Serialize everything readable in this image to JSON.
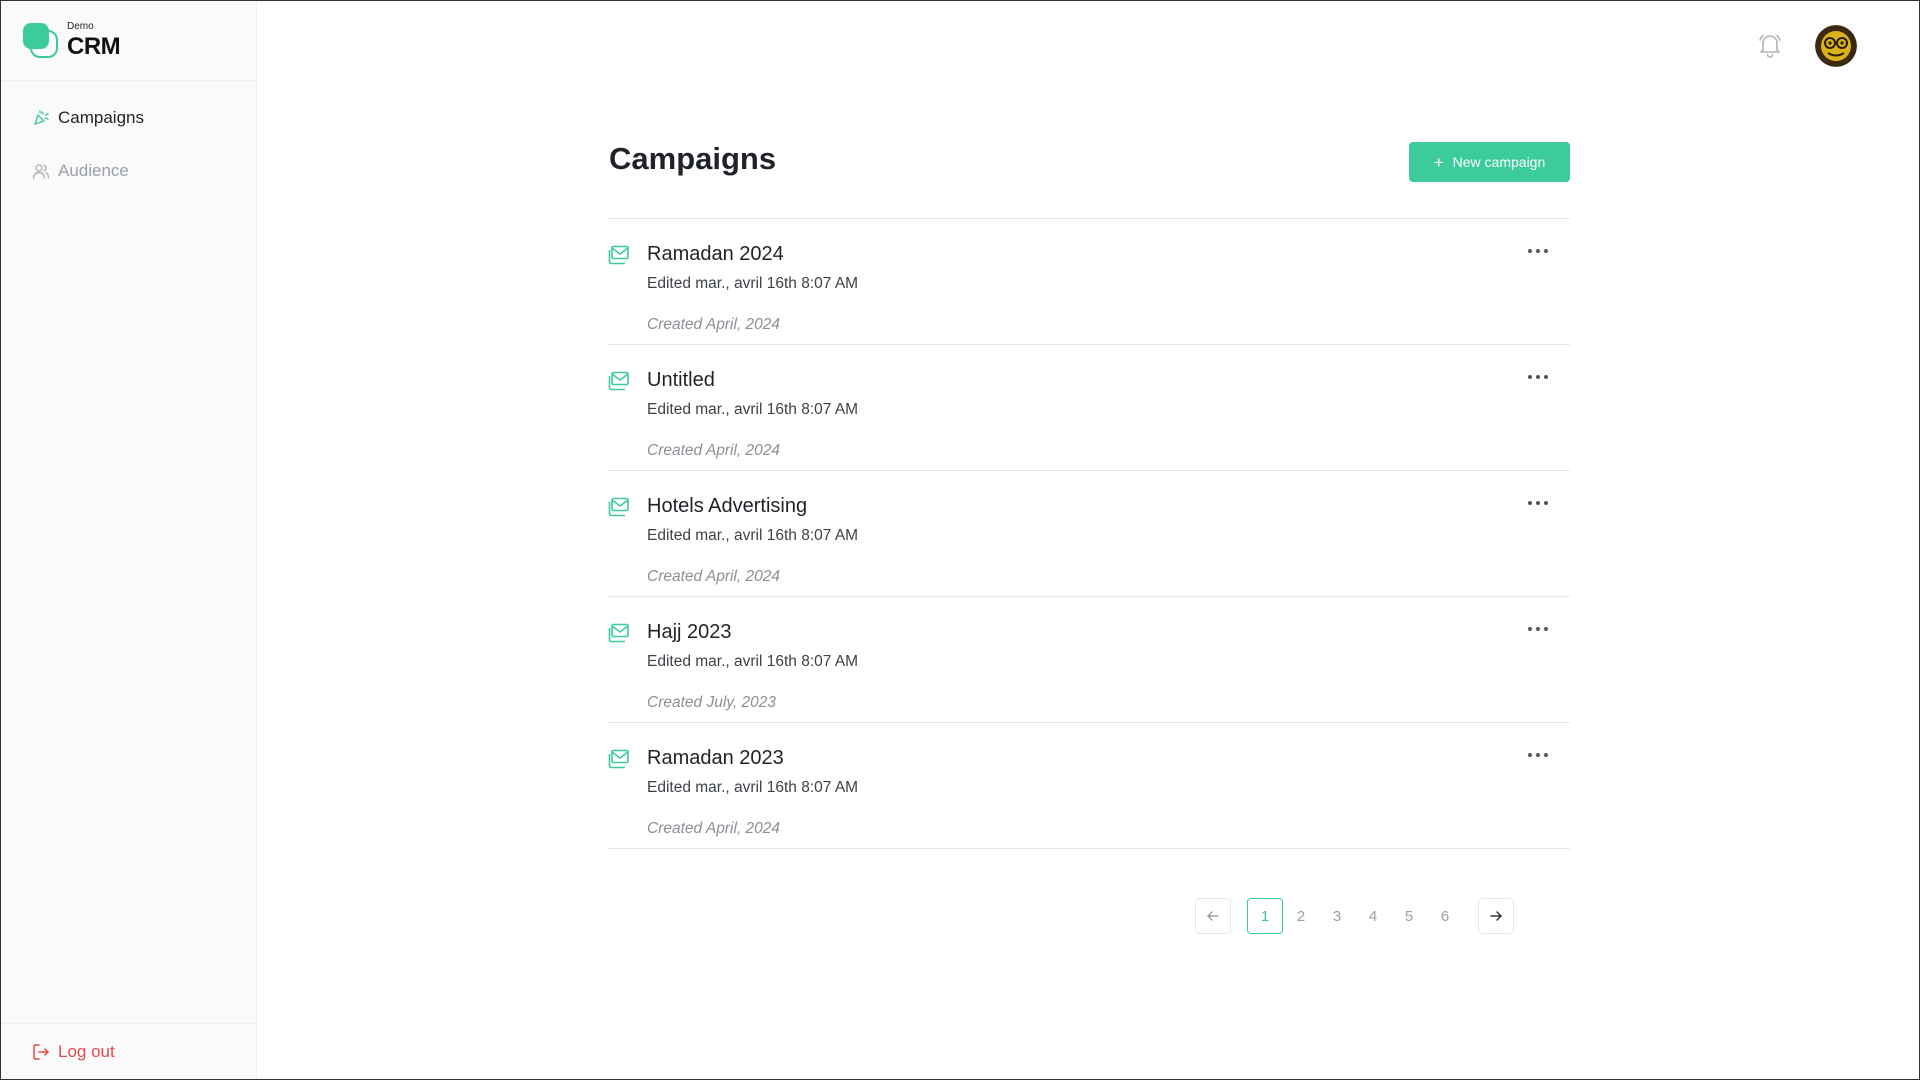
{
  "brand": {
    "small": "Demo",
    "big": "CRM"
  },
  "sidebar": {
    "items": [
      {
        "label": "Campaigns",
        "icon": "party-popper-icon",
        "active": true
      },
      {
        "label": "Audience",
        "icon": "users-icon",
        "active": false
      }
    ],
    "logout": "Log out"
  },
  "header": {
    "bell_icon": "bell-icon",
    "avatar_icon": "avatar"
  },
  "main": {
    "title": "Campaigns",
    "new_button": "New campaign",
    "campaigns": [
      {
        "title": "Ramadan 2024",
        "edited": "Edited mar., avril 16th 8:07 AM",
        "created": "Created April, 2024"
      },
      {
        "title": "Untitled",
        "edited": "Edited mar., avril 16th 8:07 AM",
        "created": "Created April, 2024"
      },
      {
        "title": "Hotels Advertising",
        "edited": "Edited mar., avril 16th 8:07 AM",
        "created": "Created April, 2024"
      },
      {
        "title": "Hajj 2023",
        "edited": "Edited mar., avril 16th 8:07 AM",
        "created": "Created July, 2023"
      },
      {
        "title": "Ramadan 2023",
        "edited": "Edited mar., avril 16th 8:07 AM",
        "created": "Created April, 2024"
      }
    ]
  },
  "pagination": {
    "pages": [
      "1",
      "2",
      "3",
      "4",
      "5",
      "6"
    ],
    "current": "1"
  },
  "colors": {
    "accent": "#3ccb9a",
    "danger": "#e5484d",
    "muted": "#9aa0a6"
  }
}
